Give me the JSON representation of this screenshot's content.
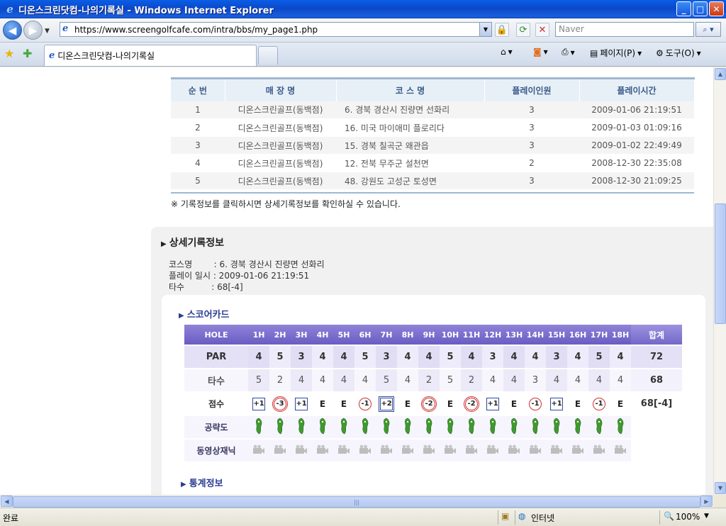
{
  "window": {
    "title": "디온스크린닷컴-나의기록실 - Windows Internet Explorer",
    "buttons": [
      "_",
      "□",
      "✕"
    ]
  },
  "address_bar": {
    "url": "https://www.screengolfcafe.com/intra/bbs/my_page1.php",
    "search_placeholder": "Naver"
  },
  "tab": {
    "title": "디온스크린닷컴-나의기록실"
  },
  "command_bar": {
    "page_label": "페이지(P)",
    "tools_label": "도구(O)"
  },
  "list": {
    "headers": [
      "순 번",
      "매 장 명",
      "코 스 명",
      "플레이인원",
      "플레이시간"
    ],
    "rows": [
      {
        "no": "1",
        "store": "디온스크린골프(동백점)",
        "course": "6. 경북 경산시 진량면 선화리",
        "players": "3",
        "time": "2009-01-06 21:19:51"
      },
      {
        "no": "2",
        "store": "디온스크린골프(동백점)",
        "course": "16. 미국 마이애미 플로리다",
        "players": "3",
        "time": "2009-01-03 01:09:16"
      },
      {
        "no": "3",
        "store": "디온스크린골프(동백점)",
        "course": "15. 경북 칠곡군 왜관읍",
        "players": "3",
        "time": "2009-01-02 22:49:49"
      },
      {
        "no": "4",
        "store": "디온스크린골프(동백점)",
        "course": "12. 전북 무주군 설천면",
        "players": "2",
        "time": "2008-12-30 22:35:08"
      },
      {
        "no": "5",
        "store": "디온스크린골프(동백점)",
        "course": "48. 강원도 고성군 토성면",
        "players": "3",
        "time": "2008-12-30 21:09:25"
      }
    ],
    "notice": "※ 기록정보를 클릭하시면 상세기록정보를 확인하실 수 있습니다."
  },
  "detail": {
    "title": "상세기록정보",
    "course_line": "코스명        : 6. 경북 경산시 진량면 선화리",
    "time_line": "플레이 일시 : 2009-01-06 21:19:51",
    "strokes_line": "타수          : 68[-4]"
  },
  "scorecard": {
    "title": "스코어카드",
    "hole_label": "HOLE",
    "holes": [
      "1H",
      "2H",
      "3H",
      "4H",
      "5H",
      "6H",
      "7H",
      "8H",
      "9H",
      "10H",
      "11H",
      "12H",
      "13H",
      "14H",
      "15H",
      "16H",
      "17H",
      "18H"
    ],
    "total_label": "합계",
    "par_label": "PAR",
    "par": [
      "4",
      "5",
      "3",
      "4",
      "4",
      "5",
      "3",
      "4",
      "4",
      "5",
      "4",
      "3",
      "4",
      "4",
      "3",
      "4",
      "5",
      "4"
    ],
    "par_total": "72",
    "stroke_label": "타수",
    "strokes": [
      "5",
      "2",
      "4",
      "4",
      "4",
      "4",
      "5",
      "4",
      "2",
      "5",
      "2",
      "4",
      "4",
      "3",
      "4",
      "4",
      "4",
      "4"
    ],
    "stroke_total": "68",
    "score_label": "점수",
    "scores": [
      {
        "text": "+1",
        "mark": "sq"
      },
      {
        "text": "-3",
        "mark": "dci"
      },
      {
        "text": "+1",
        "mark": "sq"
      },
      {
        "text": "E",
        "mark": "ev"
      },
      {
        "text": "E",
        "mark": "ev"
      },
      {
        "text": "-1",
        "mark": "ci"
      },
      {
        "text": "+2",
        "mark": "dsq"
      },
      {
        "text": "E",
        "mark": "ev"
      },
      {
        "text": "-2",
        "mark": "dci"
      },
      {
        "text": "E",
        "mark": "ev"
      },
      {
        "text": "-2",
        "mark": "dci"
      },
      {
        "text": "+1",
        "mark": "sq"
      },
      {
        "text": "E",
        "mark": "ev"
      },
      {
        "text": "-1",
        "mark": "ci"
      },
      {
        "text": "+1",
        "mark": "sq"
      },
      {
        "text": "E",
        "mark": "ev"
      },
      {
        "text": "-1",
        "mark": "ci"
      },
      {
        "text": "E",
        "mark": "ev"
      }
    ],
    "score_total": "68[-4]",
    "strategy_label": "공략도",
    "video_label": "동영상재닉"
  },
  "stats": {
    "title": "통계정보"
  },
  "status": {
    "left": "완료",
    "zone": "인터넷",
    "zoom": "100%"
  },
  "colors": {
    "header_purple": "#6a5cc3",
    "accent_blue": "#2b3c92",
    "green_icon": "#3f9a2e",
    "under_red": "#d03030"
  }
}
